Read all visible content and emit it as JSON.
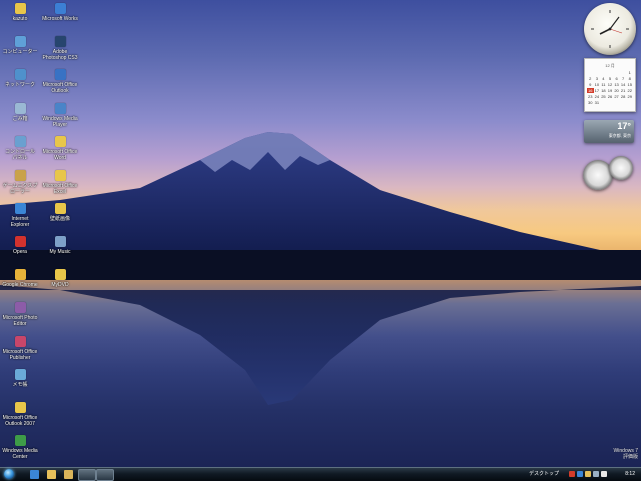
{
  "desktop_icons": [
    {
      "label": "kazuto",
      "color": "#e8c64a"
    },
    {
      "label": "Microsoft Works",
      "color": "#3c7fd4"
    },
    {
      "label": "コンピューター",
      "color": "#5fa0d8"
    },
    {
      "label": "Adobe Photoshop CS3",
      "color": "#27456e"
    },
    {
      "label": "ネットワーク",
      "color": "#4f91cc"
    },
    {
      "label": "Microsoft Office Outlook",
      "color": "#3872c4"
    },
    {
      "label": "ごみ箱",
      "color": "#9ab8d4"
    },
    {
      "label": "Windows Media Player",
      "color": "#4a84c8"
    },
    {
      "label": "コントロール パネル",
      "color": "#6aa0d0"
    },
    {
      "label": "Microsoft Office Word",
      "color": "#e8c64a"
    },
    {
      "label": "ゲームエクスプローラー",
      "color": "#c9a24a"
    },
    {
      "label": "Microsoft Office Excel",
      "color": "#e8c64a"
    },
    {
      "label": "Internet Explorer",
      "color": "#3b86d6"
    },
    {
      "label": "壁紙画像",
      "color": "#e8c64a"
    },
    {
      "label": "Opera",
      "color": "#d2322e"
    },
    {
      "label": "My Music",
      "color": "#7da0c8"
    },
    {
      "label": "Google Chrome",
      "color": "#e6b23a"
    },
    {
      "label": "MyDVD",
      "color": "#e8c64a"
    },
    {
      "label": "Microsoft Photo Editor",
      "color": "#8c5ca8"
    },
    {
      "label": "Microsoft Office Publisher",
      "color": "#c8466a"
    },
    {
      "label": "メモ帳",
      "color": "#6aaad8"
    },
    {
      "label": "Microsoft Office Outlook 2007",
      "color": "#e8c64a"
    },
    {
      "label": "Windows Media Center",
      "color": "#3e9c48"
    }
  ],
  "gadgets": {
    "calendar": {
      "month_label": "12 月",
      "days": [
        "",
        "",
        "",
        "",
        "",
        "",
        "1",
        "2",
        "3",
        "4",
        "5",
        "6",
        "7",
        "8",
        "9",
        "10",
        "11",
        "12",
        "13",
        "14",
        "15",
        "16",
        "17",
        "18",
        "19",
        "20",
        "21",
        "22",
        "23",
        "24",
        "25",
        "26",
        "27",
        "28",
        "29",
        "30",
        "31"
      ],
      "today": "16"
    },
    "weather": {
      "temperature": "17°",
      "city": "東京都, 東京"
    }
  },
  "taskbar": {
    "language": "デスクトップ",
    "time": "8:12",
    "quick_launch": [
      {
        "name": "ie",
        "color": "#3b86d6"
      },
      {
        "name": "explorer",
        "color": "#e6c05a"
      },
      {
        "name": "folder",
        "color": "#d9b45a"
      }
    ],
    "tray_icons": [
      {
        "name": "tray-1",
        "color": "#d23c2a"
      },
      {
        "name": "tray-2",
        "color": "#3b86d6"
      },
      {
        "name": "tray-3",
        "color": "#e6c05a"
      },
      {
        "name": "tray-4",
        "color": "#9ab0c4"
      },
      {
        "name": "tray-5",
        "color": "#e8e8e8"
      }
    ]
  },
  "watermark": {
    "line1": "Windows 7",
    "line2": "評価版"
  }
}
